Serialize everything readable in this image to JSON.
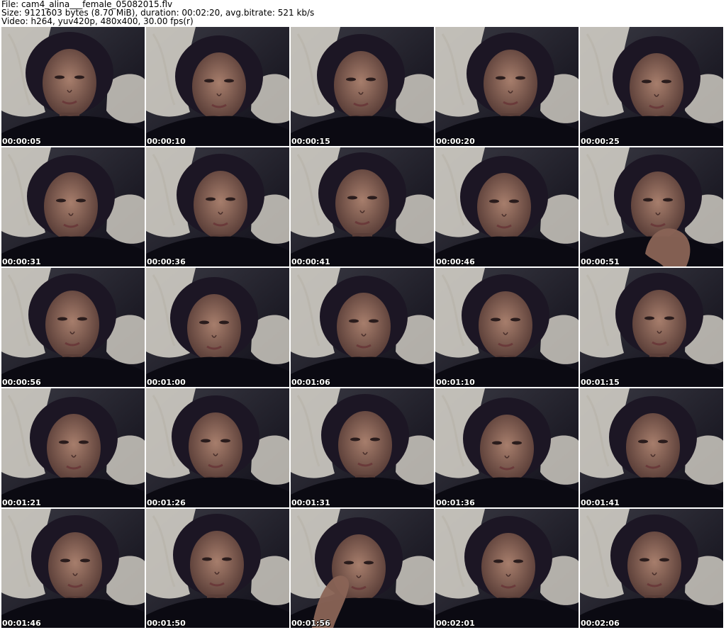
{
  "header": {
    "file_line": "File: cam4_alina___female_05082015.flv",
    "size_line": "Size: 9121603 bytes (8.70 MiB), duration: 00:02:20, avg.bitrate: 521 kb/s",
    "video_line": "Video: h264, yuv420p, 480x400, 30.00 fps(r)"
  },
  "thumbnails": [
    {
      "timestamp": "00:00:05",
      "variant": "default"
    },
    {
      "timestamp": "00:00:10",
      "variant": "default"
    },
    {
      "timestamp": "00:00:15",
      "variant": "default"
    },
    {
      "timestamp": "00:00:20",
      "variant": "default"
    },
    {
      "timestamp": "00:00:25",
      "variant": "default"
    },
    {
      "timestamp": "00:00:31",
      "variant": "default"
    },
    {
      "timestamp": "00:00:36",
      "variant": "default"
    },
    {
      "timestamp": "00:00:41",
      "variant": "default"
    },
    {
      "timestamp": "00:00:46",
      "variant": "default"
    },
    {
      "timestamp": "00:00:51",
      "variant": "hand"
    },
    {
      "timestamp": "00:00:56",
      "variant": "default"
    },
    {
      "timestamp": "00:01:00",
      "variant": "default"
    },
    {
      "timestamp": "00:01:06",
      "variant": "default"
    },
    {
      "timestamp": "00:01:10",
      "variant": "default"
    },
    {
      "timestamp": "00:01:15",
      "variant": "default"
    },
    {
      "timestamp": "00:01:21",
      "variant": "default"
    },
    {
      "timestamp": "00:01:26",
      "variant": "default"
    },
    {
      "timestamp": "00:01:31",
      "variant": "default"
    },
    {
      "timestamp": "00:01:36",
      "variant": "default"
    },
    {
      "timestamp": "00:01:41",
      "variant": "default"
    },
    {
      "timestamp": "00:01:46",
      "variant": "default"
    },
    {
      "timestamp": "00:01:50",
      "variant": "default"
    },
    {
      "timestamp": "00:01:56",
      "variant": "hand-left"
    },
    {
      "timestamp": "00:02:01",
      "variant": "default"
    },
    {
      "timestamp": "00:02:06",
      "variant": "default"
    }
  ],
  "colors": {
    "background": "#ffffff",
    "frame_dark": "#14121c",
    "pillow": "#d9d6cc",
    "skin": "#8a6456",
    "hair": "#1c1624",
    "timestamp_text": "#ffffff"
  }
}
